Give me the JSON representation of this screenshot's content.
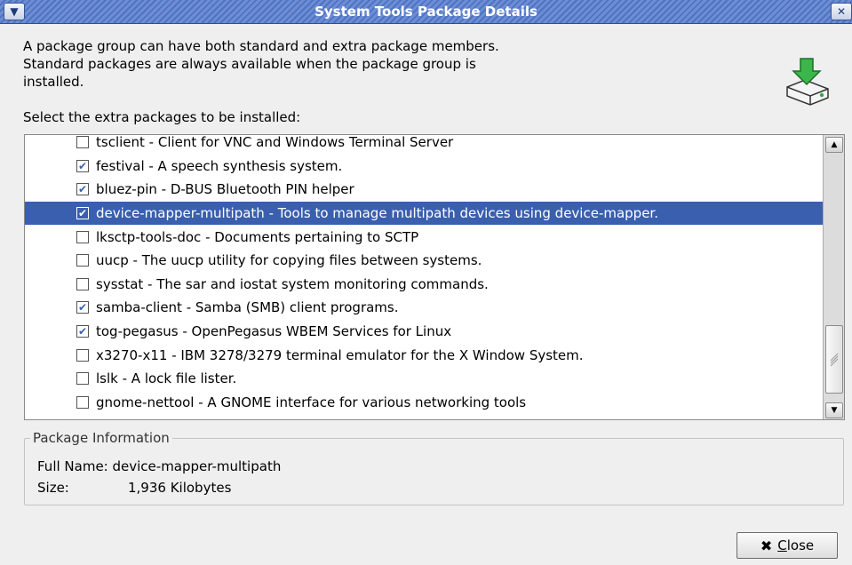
{
  "window": {
    "title": "System Tools Package Details",
    "menu_icon": "chevron-down-icon",
    "close_icon": "close-icon"
  },
  "intro_text": "A package group can have both standard and extra package members.  Standard packages are always available when the package group is installed.",
  "select_label": "Select the extra packages to be installed:",
  "packages": [
    {
      "label": "tsclient - Client for VNC and Windows Terminal Server",
      "checked": false,
      "selected": false
    },
    {
      "label": "festival - A speech synthesis system.",
      "checked": true,
      "selected": false
    },
    {
      "label": "bluez-pin - D-BUS Bluetooth PIN helper",
      "checked": true,
      "selected": false
    },
    {
      "label": "device-mapper-multipath - Tools to manage multipath devices using device-mapper.",
      "checked": true,
      "selected": true
    },
    {
      "label": "lksctp-tools-doc - Documents pertaining to SCTP",
      "checked": false,
      "selected": false
    },
    {
      "label": "uucp - The uucp utility for copying files between systems.",
      "checked": false,
      "selected": false
    },
    {
      "label": "sysstat - The sar and iostat system monitoring commands.",
      "checked": false,
      "selected": false
    },
    {
      "label": "samba-client - Samba (SMB) client programs.",
      "checked": true,
      "selected": false
    },
    {
      "label": "tog-pegasus - OpenPegasus WBEM Services for Linux",
      "checked": true,
      "selected": false
    },
    {
      "label": "x3270-x11 - IBM 3278/3279 terminal emulator for the X Window System.",
      "checked": false,
      "selected": false
    },
    {
      "label": "lslk - A lock file lister.",
      "checked": false,
      "selected": false
    },
    {
      "label": "gnome-nettool - A GNOME interface for various networking tools",
      "checked": false,
      "selected": false
    }
  ],
  "info": {
    "legend": "Package Information",
    "full_name_label": "Full Name:",
    "full_name_value": "device-mapper-multipath",
    "size_label": "Size:",
    "size_value": "1,936 Kilobytes"
  },
  "close_button": {
    "label": "Close",
    "icon": "close-icon"
  },
  "colors": {
    "selection": "#3a5fae",
    "titlebar": "#5a7cc8"
  }
}
